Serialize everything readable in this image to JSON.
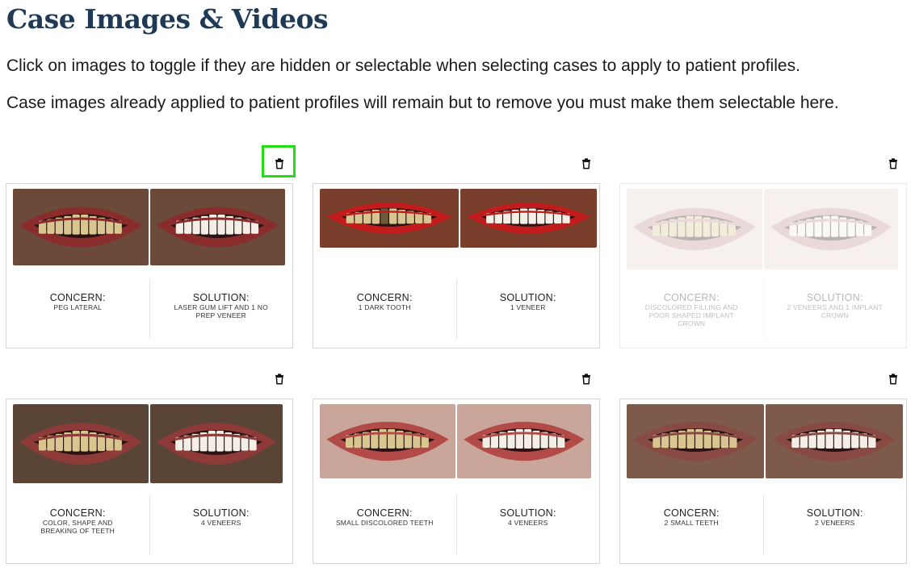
{
  "page": {
    "title": "Case Images & Videos",
    "instructions": [
      "Click on images to toggle if they are hidden or selectable when selecting cases to apply to patient profiles.",
      "Case images already applied to patient profiles will remain but to remove you must make them selectable here."
    ]
  },
  "icons": {
    "delete": "trash-icon",
    "focus_color": "#22dd11"
  },
  "colors": {
    "title": "#1f3a55",
    "border": "#d6d6d6"
  },
  "cases": [
    {
      "concern_label": "CONCERN:",
      "concern": "PEG LATERAL",
      "solution_label": "SOLUTION:",
      "solution": "LASER GUM LIFT AND 1 NO PREP VENEER",
      "hidden": false
    },
    {
      "concern_label": "CONCERN:",
      "concern": "1 DARK TOOTH",
      "solution_label": "SOLUTION:",
      "solution": "1 VENEER",
      "hidden": false
    },
    {
      "concern_label": "CONCERN:",
      "concern": "DISCOLORED FILLING AND POOR SHAPED IMPLANT CROWN",
      "solution_label": "SOLUTION:",
      "solution": "2 VENEERS AND 1 IMPLANT CROWN",
      "hidden": true
    },
    {
      "concern_label": "CONCERN:",
      "concern": "COLOR, SHAPE AND BREAKING OF TEETH",
      "solution_label": "SOLUTION:",
      "solution": "4 VENEERS",
      "hidden": false
    },
    {
      "concern_label": "CONCERN:",
      "concern": "SMALL DISCOLORED TEETH",
      "solution_label": "SOLUTION:",
      "solution": "4 VENEERS",
      "hidden": false
    },
    {
      "concern_label": "CONCERN:",
      "concern": "2 SMALL TEETH",
      "solution_label": "SOLUTION:",
      "solution": "2 VENEERS",
      "hidden": false
    }
  ]
}
